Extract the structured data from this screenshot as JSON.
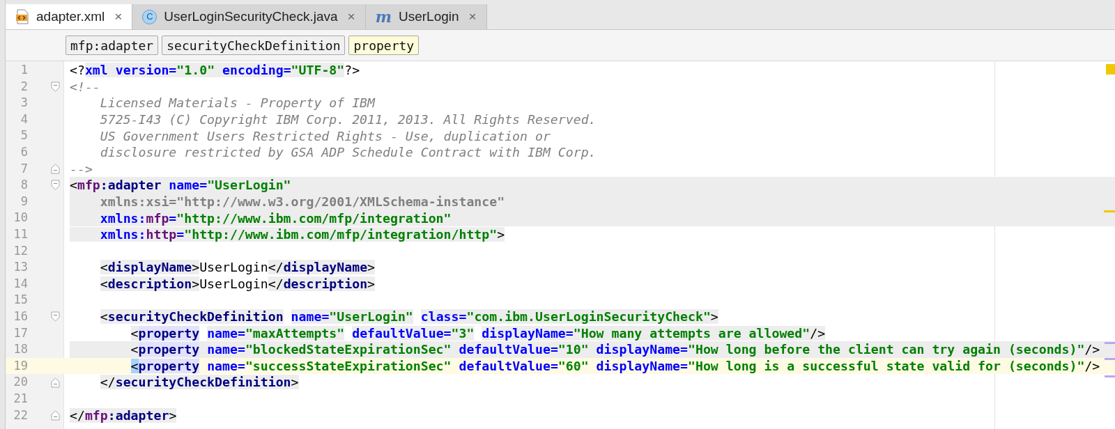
{
  "tabs": [
    {
      "label": "adapter.xml",
      "kind": "xml",
      "selected": true
    },
    {
      "label": "UserLoginSecurityCheck.java",
      "kind": "class",
      "icon_letter": "C",
      "selected": false
    },
    {
      "label": "UserLogin",
      "kind": "module",
      "icon_letter": "m",
      "selected": false
    }
  ],
  "tab_close": "×",
  "breadcrumbs": [
    {
      "label": "mfp:adapter",
      "selected": false
    },
    {
      "label": "securityCheckDefinition",
      "selected": false
    },
    {
      "label": "property",
      "selected": true
    }
  ],
  "lines": [
    {
      "number": "1",
      "tokens": [
        {
          "t": "<?",
          "kind": "punct"
        },
        {
          "t": "xml",
          "kind": "attr",
          "highlighted": true
        },
        {
          "t": " version=",
          "kind": "attr",
          "highlighted": true
        },
        {
          "t": "\"1.0\"",
          "kind": "value",
          "highlighted": true
        },
        {
          "t": " encoding=",
          "kind": "attr",
          "highlighted": true
        },
        {
          "t": "\"UTF-8\"",
          "kind": "value",
          "highlighted": true
        },
        {
          "t": "?>",
          "kind": "punct"
        }
      ]
    },
    {
      "number": "2",
      "fold_start": true,
      "tokens": [
        {
          "t": "<!--",
          "kind": "comment"
        }
      ]
    },
    {
      "number": "3",
      "tokens": [
        {
          "t": "    Licensed Materials - Property of IBM",
          "kind": "comment"
        }
      ]
    },
    {
      "number": "4",
      "tokens": [
        {
          "t": "    5725-I43 (C) Copyright IBM Corp. 2011, 2013. All Rights Reserved.",
          "kind": "comment"
        }
      ]
    },
    {
      "number": "5",
      "tokens": [
        {
          "t": "    US Government Users Restricted Rights - Use, duplication or",
          "kind": "comment"
        }
      ]
    },
    {
      "number": "6",
      "tokens": [
        {
          "t": "    disclosure restricted by GSA ADP Schedule Contract with IBM Corp.",
          "kind": "comment"
        }
      ]
    },
    {
      "number": "7",
      "fold_end": true,
      "tokens": [
        {
          "t": "-->",
          "kind": "comment"
        }
      ]
    },
    {
      "number": "8",
      "fold_start": true,
      "in_block": true,
      "tokens": [
        {
          "t": "<",
          "kind": "punct"
        },
        {
          "t": "mfp",
          "kind": "ns"
        },
        {
          "t": ":adapter",
          "kind": "tag"
        },
        {
          "t": " name=",
          "kind": "attr"
        },
        {
          "t": "\"UserLogin\"",
          "kind": "value"
        }
      ]
    },
    {
      "number": "9",
      "in_block": true,
      "tokens": [
        {
          "t": "    xmlns:xsi=\"http://www.w3.org/2001/XMLSchema-instance\"",
          "kind": "unused"
        }
      ]
    },
    {
      "number": "10",
      "in_block": true,
      "tokens": [
        {
          "t": "    xmlns:",
          "kind": "attr"
        },
        {
          "t": "mfp",
          "kind": "ns"
        },
        {
          "t": "=",
          "kind": "attr"
        },
        {
          "t": "\"http://www.ibm.com/mfp/integration\"",
          "kind": "value"
        }
      ]
    },
    {
      "number": "11",
      "tokens": [
        {
          "t": "    xmlns:",
          "kind": "attr",
          "highlighted": true
        },
        {
          "t": "http",
          "kind": "ns",
          "highlighted": true
        },
        {
          "t": "=",
          "kind": "attr",
          "highlighted": true
        },
        {
          "t": "\"http://www.ibm.com/mfp/integration/http\"",
          "kind": "value",
          "highlighted": true
        },
        {
          "t": ">",
          "kind": "punct",
          "highlighted": true
        }
      ]
    },
    {
      "number": "12"
    },
    {
      "number": "13",
      "tokens": [
        {
          "t": "    <",
          "kind": "punct",
          "highlighted": true
        },
        {
          "t": "displayName",
          "kind": "tag",
          "highlighted": true
        },
        {
          "t": ">",
          "kind": "punct",
          "highlighted": true
        },
        {
          "t": "UserLogin",
          "kind": "text"
        },
        {
          "t": "</",
          "kind": "punct",
          "highlighted": true
        },
        {
          "t": "displayName",
          "kind": "tag",
          "highlighted": true
        },
        {
          "t": ">",
          "kind": "punct",
          "highlighted": true
        }
      ]
    },
    {
      "number": "14",
      "tokens": [
        {
          "t": "    <",
          "kind": "punct",
          "highlighted": true
        },
        {
          "t": "description",
          "kind": "tag",
          "highlighted": true
        },
        {
          "t": ">",
          "kind": "punct",
          "highlighted": true
        },
        {
          "t": "UserLogin",
          "kind": "text"
        },
        {
          "t": "</",
          "kind": "punct",
          "highlighted": true
        },
        {
          "t": "description",
          "kind": "tag",
          "highlighted": true
        },
        {
          "t": ">",
          "kind": "punct",
          "highlighted": true
        }
      ]
    },
    {
      "number": "15"
    },
    {
      "number": "16",
      "fold_start": true,
      "tokens": [
        {
          "t": "    <",
          "kind": "punct",
          "highlighted": true
        },
        {
          "t": "securityCheckDefinition",
          "kind": "tag",
          "highlighted": true
        },
        {
          "t": " name=",
          "kind": "attr",
          "highlighted": true
        },
        {
          "t": "\"UserLogin\"",
          "kind": "value",
          "highlighted": true
        },
        {
          "t": " class=",
          "kind": "attr",
          "highlighted": true
        },
        {
          "t": "\"com.ibm.UserLoginSecurityCheck\"",
          "kind": "value",
          "highlighted": true
        },
        {
          "t": ">",
          "kind": "punct",
          "highlighted": true
        }
      ]
    },
    {
      "number": "17",
      "tokens": [
        {
          "t": "        <",
          "kind": "punct",
          "highlighted": true
        },
        {
          "t": "property",
          "kind": "tag",
          "matched": true
        },
        {
          "t": " name=",
          "kind": "attr",
          "highlighted": true
        },
        {
          "t": "\"maxAttempts\"",
          "kind": "value",
          "highlighted": true
        },
        {
          "t": " defaultValue=",
          "kind": "attr",
          "highlighted": true
        },
        {
          "t": "\"3\"",
          "kind": "value",
          "highlighted": true
        },
        {
          "t": " displayName=",
          "kind": "attr",
          "highlighted": true
        },
        {
          "t": "\"How many attempts are allowed\"",
          "kind": "value",
          "highlighted": true
        },
        {
          "t": "/>",
          "kind": "punct",
          "highlighted": true
        }
      ]
    },
    {
      "number": "18",
      "in_block": true,
      "tokens": [
        {
          "t": "        <",
          "kind": "punct"
        },
        {
          "t": "property",
          "kind": "tag",
          "matched": true
        },
        {
          "t": " name=",
          "kind": "attr"
        },
        {
          "t": "\"blockedStateExpirationSec\"",
          "kind": "value"
        },
        {
          "t": " defaultValue=",
          "kind": "attr"
        },
        {
          "t": "\"10\"",
          "kind": "value"
        },
        {
          "t": " displayName=",
          "kind": "attr"
        },
        {
          "t": "\"How long before the client can try again (seconds)\"",
          "kind": "value"
        },
        {
          "t": "/>",
          "kind": "punct"
        }
      ]
    },
    {
      "number": "19",
      "current": true,
      "tokens": [
        {
          "t": "        <",
          "kind": "punct",
          "at_caret": true
        },
        {
          "t": "property",
          "kind": "tag",
          "matched": true
        },
        {
          "t": " name=",
          "kind": "attr"
        },
        {
          "t": "\"successStateExpirationSec\"",
          "kind": "value"
        },
        {
          "t": " defaultValue=",
          "kind": "attr"
        },
        {
          "t": "\"60\"",
          "kind": "value"
        },
        {
          "t": " displayName=",
          "kind": "attr"
        },
        {
          "t": "\"How long is a successful state valid for (seconds)\"",
          "kind": "value"
        },
        {
          "t": "/>",
          "kind": "punct"
        }
      ]
    },
    {
      "number": "20",
      "fold_end": true,
      "tokens": [
        {
          "t": "    </",
          "kind": "punct",
          "highlighted": true
        },
        {
          "t": "securityCheckDefinition",
          "kind": "tag",
          "highlighted": true
        },
        {
          "t": ">",
          "kind": "punct",
          "highlighted": true
        }
      ]
    },
    {
      "number": "21"
    },
    {
      "number": "22",
      "fold_end": true,
      "tokens": [
        {
          "t": "</",
          "kind": "punct",
          "highlighted": true
        },
        {
          "t": "mfp",
          "kind": "ns",
          "highlighted": true
        },
        {
          "t": ":adapter",
          "kind": "tag",
          "highlighted": true
        },
        {
          "t": ">",
          "kind": "punct",
          "highlighted": true
        }
      ]
    }
  ]
}
